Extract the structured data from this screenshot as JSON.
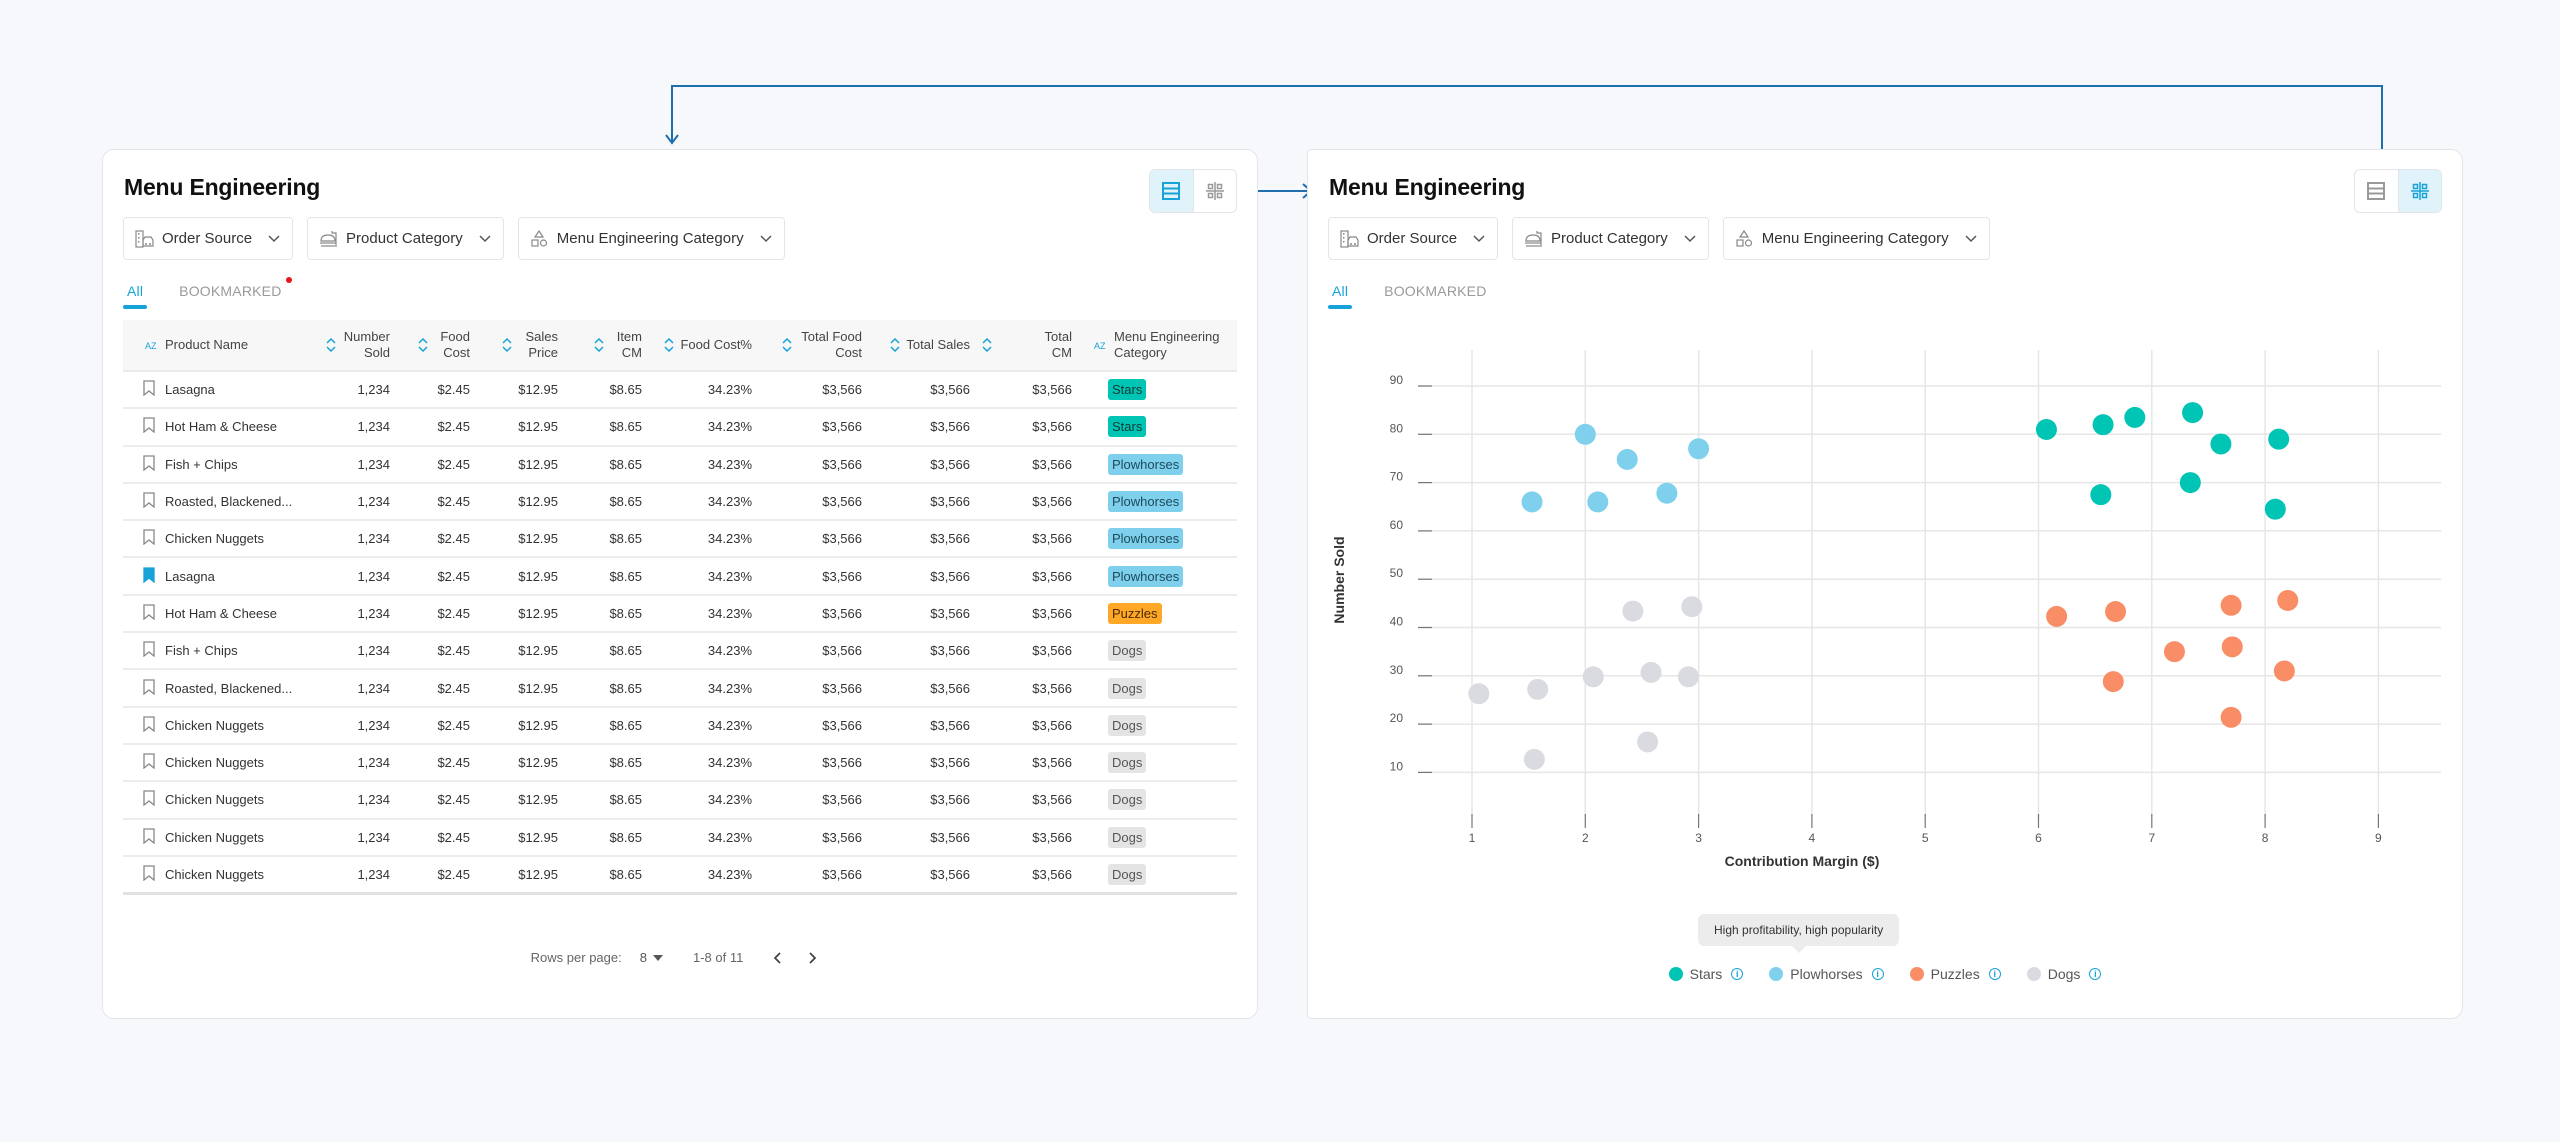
{
  "colors": {
    "accent": "#17a2d8",
    "connector": "#1f6fad",
    "stars": "#00c4b4",
    "plowhorses": "#7fd0ec",
    "puzzles": "#f98e66",
    "dogs": "#dadbe0",
    "puzzles_badge": "#ffa726"
  },
  "left_panel": {
    "title": "Menu Engineering",
    "view_toggle": {
      "table_view_active": true
    },
    "filters": [
      {
        "label": "Order Source",
        "icon": "order-source-icon"
      },
      {
        "label": "Product Category",
        "icon": "product-category-icon"
      },
      {
        "label": "Menu Engineering Category",
        "icon": "shapes-icon"
      }
    ],
    "tabs": [
      {
        "label": "All",
        "active": true
      },
      {
        "label": "BOOKMARKED",
        "active": false,
        "has_notification": true
      }
    ],
    "table": {
      "columns": [
        {
          "label": "Product Name",
          "sort": "az"
        },
        {
          "label": "Number Sold",
          "sort": "updown"
        },
        {
          "label": "Food Cost",
          "sort": "updown"
        },
        {
          "label": "Sales Price",
          "sort": "updown"
        },
        {
          "label": "Item CM",
          "sort": "updown"
        },
        {
          "label": "Food Cost%",
          "sort": "updown"
        },
        {
          "label": "Total Food Cost",
          "sort": "updown"
        },
        {
          "label": "Total Sales",
          "sort": "updown"
        },
        {
          "label": "Total CM",
          "sort": "updown"
        },
        {
          "label": "Menu Engineering Category",
          "sort": "az"
        }
      ],
      "rows": [
        {
          "bookmarked": false,
          "name": "Lasagna",
          "number_sold": "1,234",
          "food_cost": "$2.45",
          "sales_price": "$12.95",
          "item_cm": "$8.65",
          "food_cost_pct": "34.23%",
          "total_food_cost": "$3,566",
          "total_sales": "$3,566",
          "total_cm": "$3,566",
          "category": "Stars"
        },
        {
          "bookmarked": false,
          "name": "Hot Ham & Cheese",
          "number_sold": "1,234",
          "food_cost": "$2.45",
          "sales_price": "$12.95",
          "item_cm": "$8.65",
          "food_cost_pct": "34.23%",
          "total_food_cost": "$3,566",
          "total_sales": "$3,566",
          "total_cm": "$3,566",
          "category": "Stars"
        },
        {
          "bookmarked": false,
          "name": "Fish + Chips",
          "number_sold": "1,234",
          "food_cost": "$2.45",
          "sales_price": "$12.95",
          "item_cm": "$8.65",
          "food_cost_pct": "34.23%",
          "total_food_cost": "$3,566",
          "total_sales": "$3,566",
          "total_cm": "$3,566",
          "category": "Plowhorses"
        },
        {
          "bookmarked": false,
          "name": "Roasted, Blackened...",
          "number_sold": "1,234",
          "food_cost": "$2.45",
          "sales_price": "$12.95",
          "item_cm": "$8.65",
          "food_cost_pct": "34.23%",
          "total_food_cost": "$3,566",
          "total_sales": "$3,566",
          "total_cm": "$3,566",
          "category": "Plowhorses"
        },
        {
          "bookmarked": false,
          "name": "Chicken Nuggets",
          "number_sold": "1,234",
          "food_cost": "$2.45",
          "sales_price": "$12.95",
          "item_cm": "$8.65",
          "food_cost_pct": "34.23%",
          "total_food_cost": "$3,566",
          "total_sales": "$3,566",
          "total_cm": "$3,566",
          "category": "Plowhorses"
        },
        {
          "bookmarked": true,
          "name": "Lasagna",
          "number_sold": "1,234",
          "food_cost": "$2.45",
          "sales_price": "$12.95",
          "item_cm": "$8.65",
          "food_cost_pct": "34.23%",
          "total_food_cost": "$3,566",
          "total_sales": "$3,566",
          "total_cm": "$3,566",
          "category": "Plowhorses"
        },
        {
          "bookmarked": false,
          "name": "Hot Ham & Cheese",
          "number_sold": "1,234",
          "food_cost": "$2.45",
          "sales_price": "$12.95",
          "item_cm": "$8.65",
          "food_cost_pct": "34.23%",
          "total_food_cost": "$3,566",
          "total_sales": "$3,566",
          "total_cm": "$3,566",
          "category": "Puzzles"
        },
        {
          "bookmarked": false,
          "name": "Fish + Chips",
          "number_sold": "1,234",
          "food_cost": "$2.45",
          "sales_price": "$12.95",
          "item_cm": "$8.65",
          "food_cost_pct": "34.23%",
          "total_food_cost": "$3,566",
          "total_sales": "$3,566",
          "total_cm": "$3,566",
          "category": "Dogs"
        },
        {
          "bookmarked": false,
          "name": "Roasted, Blackened...",
          "number_sold": "1,234",
          "food_cost": "$2.45",
          "sales_price": "$12.95",
          "item_cm": "$8.65",
          "food_cost_pct": "34.23%",
          "total_food_cost": "$3,566",
          "total_sales": "$3,566",
          "total_cm": "$3,566",
          "category": "Dogs"
        },
        {
          "bookmarked": false,
          "name": "Chicken Nuggets",
          "number_sold": "1,234",
          "food_cost": "$2.45",
          "sales_price": "$12.95",
          "item_cm": "$8.65",
          "food_cost_pct": "34.23%",
          "total_food_cost": "$3,566",
          "total_sales": "$3,566",
          "total_cm": "$3,566",
          "category": "Dogs"
        },
        {
          "bookmarked": false,
          "name": "Chicken Nuggets",
          "number_sold": "1,234",
          "food_cost": "$2.45",
          "sales_price": "$12.95",
          "item_cm": "$8.65",
          "food_cost_pct": "34.23%",
          "total_food_cost": "$3,566",
          "total_sales": "$3,566",
          "total_cm": "$3,566",
          "category": "Dogs"
        },
        {
          "bookmarked": false,
          "name": "Chicken Nuggets",
          "number_sold": "1,234",
          "food_cost": "$2.45",
          "sales_price": "$12.95",
          "item_cm": "$8.65",
          "food_cost_pct": "34.23%",
          "total_food_cost": "$3,566",
          "total_sales": "$3,566",
          "total_cm": "$3,566",
          "category": "Dogs"
        },
        {
          "bookmarked": false,
          "name": "Chicken Nuggets",
          "number_sold": "1,234",
          "food_cost": "$2.45",
          "sales_price": "$12.95",
          "item_cm": "$8.65",
          "food_cost_pct": "34.23%",
          "total_food_cost": "$3,566",
          "total_sales": "$3,566",
          "total_cm": "$3,566",
          "category": "Dogs"
        },
        {
          "bookmarked": false,
          "name": "Chicken Nuggets",
          "number_sold": "1,234",
          "food_cost": "$2.45",
          "sales_price": "$12.95",
          "item_cm": "$8.65",
          "food_cost_pct": "34.23%",
          "total_food_cost": "$3,566",
          "total_sales": "$3,566",
          "total_cm": "$3,566",
          "category": "Dogs"
        }
      ]
    },
    "pagination": {
      "rows_per_page_label": "Rows per page:",
      "rows_per_page": "8",
      "range": "1-8 of 11"
    }
  },
  "right_panel": {
    "title": "Menu Engineering",
    "view_toggle": {
      "chart_view_active": true
    },
    "filters": [
      {
        "label": "Order Source",
        "icon": "order-source-icon"
      },
      {
        "label": "Product Category",
        "icon": "product-category-icon"
      },
      {
        "label": "Menu Engineering Category",
        "icon": "shapes-icon"
      }
    ],
    "tabs": [
      {
        "label": "All",
        "active": true
      },
      {
        "label": "BOOKMARKED",
        "active": false
      }
    ],
    "tooltip": "High profitability, high popularity"
  },
  "chart_data": {
    "type": "scatter",
    "title": "",
    "xlabel": "Contribution Margin ($)",
    "ylabel": "Number Sold",
    "xlim": [
      1,
      9
    ],
    "ylim": [
      10,
      90
    ],
    "xticks": [
      1,
      2,
      3,
      4,
      5,
      6,
      7,
      8,
      9
    ],
    "yticks": [
      10,
      20,
      30,
      40,
      50,
      60,
      70,
      80,
      90
    ],
    "grid": true,
    "legend_position": "bottom-center",
    "series": [
      {
        "name": "Stars",
        "color": "#00c4b4",
        "points": [
          [
            6.07,
            81
          ],
          [
            6.57,
            82
          ],
          [
            6.85,
            83.5
          ],
          [
            7.36,
            84.5
          ],
          [
            7.61,
            78
          ],
          [
            8.12,
            79
          ],
          [
            6.55,
            67.5
          ],
          [
            7.34,
            70
          ],
          [
            8.09,
            64.5
          ]
        ]
      },
      {
        "name": "Plowhorses",
        "color": "#7fd0ec",
        "points": [
          [
            2.0,
            80
          ],
          [
            2.37,
            74.8
          ],
          [
            3.0,
            77
          ],
          [
            1.53,
            66
          ],
          [
            2.11,
            66
          ],
          [
            2.72,
            67.8
          ]
        ]
      },
      {
        "name": "Puzzles",
        "color": "#f98e66",
        "points": [
          [
            6.16,
            42.3
          ],
          [
            6.68,
            43.3
          ],
          [
            7.7,
            44.6
          ],
          [
            8.2,
            45.6
          ],
          [
            7.2,
            35
          ],
          [
            7.71,
            36
          ],
          [
            8.17,
            31
          ],
          [
            6.66,
            28.8
          ],
          [
            7.7,
            21.4
          ]
        ]
      },
      {
        "name": "Dogs",
        "color": "#dadbe0",
        "points": [
          [
            1.06,
            26.3
          ],
          [
            1.58,
            27.2
          ],
          [
            2.07,
            29.8
          ],
          [
            2.58,
            30.7
          ],
          [
            2.91,
            29.8
          ],
          [
            2.42,
            43.4
          ],
          [
            2.94,
            44.3
          ],
          [
            1.55,
            12.7
          ],
          [
            2.55,
            16.3
          ]
        ]
      }
    ]
  }
}
